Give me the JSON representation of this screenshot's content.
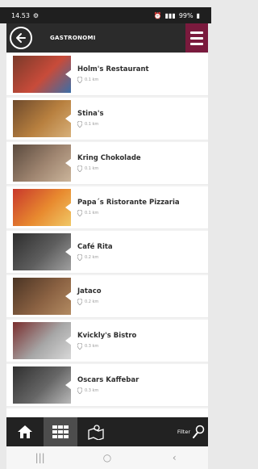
{
  "status_bar": {
    "time": "14.53",
    "battery": "99%"
  },
  "header": {
    "title": "GASTRONOMI"
  },
  "restaurants": [
    {
      "name": "Holm's Restaurant",
      "distance": "0.1 km",
      "thumb": [
        "#7a3a2a",
        "#c84b3a",
        "#3b6ea8"
      ]
    },
    {
      "name": "Stina's",
      "distance": "0.1 km",
      "thumb": [
        "#6e4a2c",
        "#b8803f",
        "#d7b07a"
      ]
    },
    {
      "name": "Kring Chokolade",
      "distance": "0.1 km",
      "thumb": [
        "#5a4a3e",
        "#9f8570",
        "#cbb59b"
      ]
    },
    {
      "name": "Papa´s Ristorante Pizzaria",
      "distance": "0.1 km",
      "thumb": [
        "#c8382c",
        "#e88a2f",
        "#f0c866"
      ]
    },
    {
      "name": "Café Rita",
      "distance": "0.2 km",
      "thumb": [
        "#2d2d2d",
        "#5e5e5e",
        "#a0a0a0"
      ]
    },
    {
      "name": "Jataco",
      "distance": "0.2 km",
      "thumb": [
        "#4a3424",
        "#8a6142",
        "#b38b62"
      ]
    },
    {
      "name": "Kvickly's Bistro",
      "distance": "0.3 km",
      "thumb": [
        "#7a2e2e",
        "#a6a6a6",
        "#d8d8d8"
      ]
    },
    {
      "name": "Oscars Kaffebar",
      "distance": "0.3 km",
      "thumb": [
        "#2f2f2f",
        "#666",
        "#b9b9b9"
      ]
    }
  ],
  "bottom_nav": {
    "filter_label": "Filter"
  },
  "colors": {
    "accent": "#7a1a3d",
    "header": "#2b2b2b",
    "nav": "#222222"
  }
}
